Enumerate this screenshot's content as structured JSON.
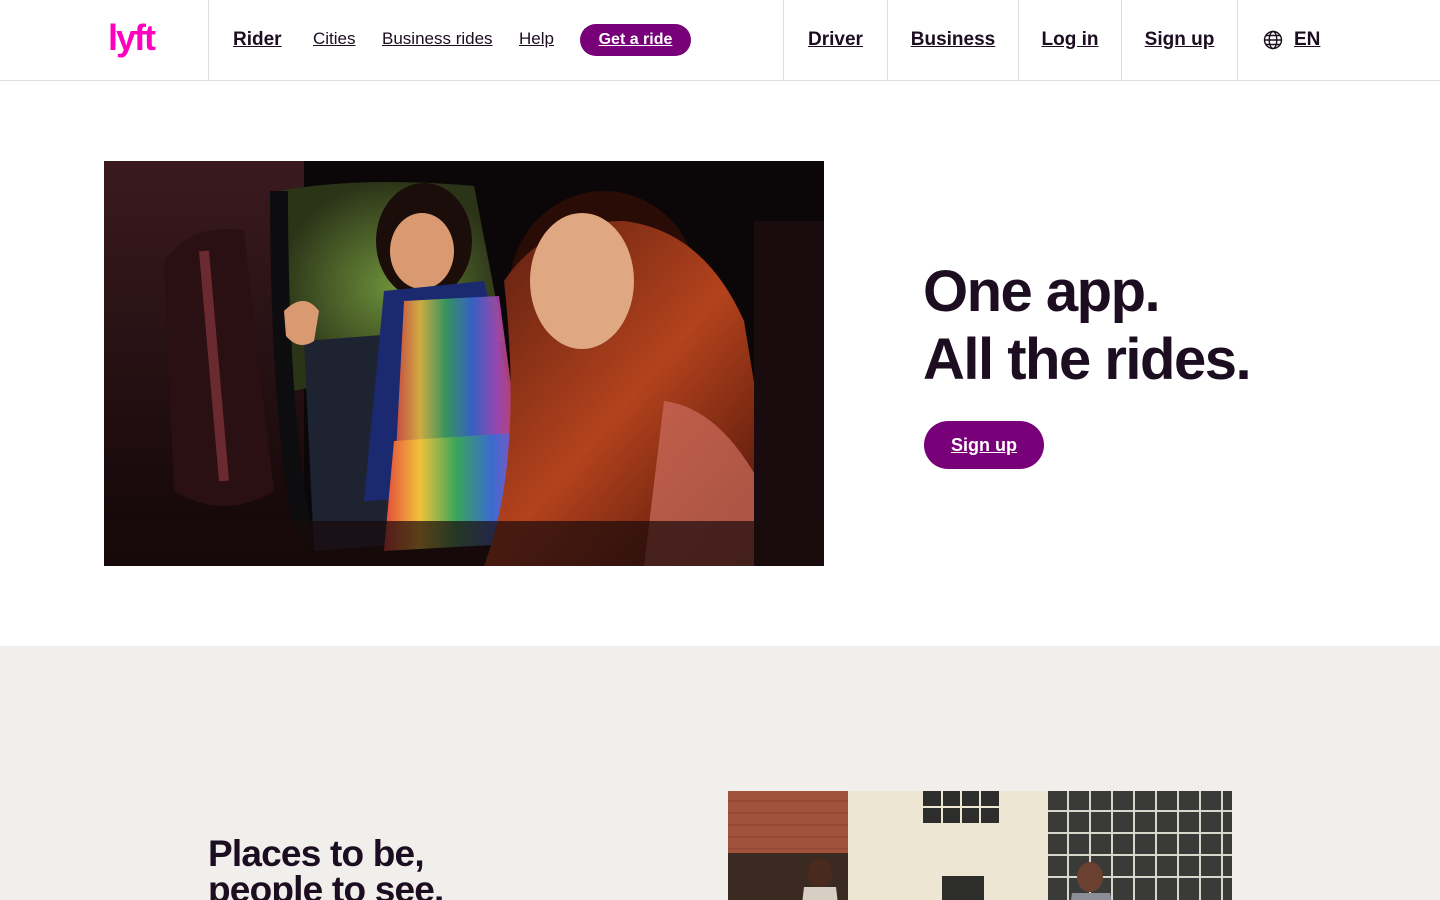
{
  "header": {
    "logo_text": "lyft",
    "nav_primary": "Rider",
    "nav_links": [
      "Cities",
      "Business rides",
      "Help"
    ],
    "cta_label": "Get a ride",
    "nav_right": [
      "Driver",
      "Business",
      "Log in",
      "Sign up"
    ],
    "language": "EN",
    "language_icon": "globe-icon"
  },
  "hero": {
    "title_line1": "One app.",
    "title_line2": "All the rides.",
    "signup_label": "Sign up"
  },
  "section2": {
    "title_line1": "Places to be,",
    "title_line2": "people to see."
  },
  "colors": {
    "brand_pink": "#ff00bf",
    "brand_purple": "#780078",
    "text_dark": "#1c0d20",
    "section_bg": "#f1efec"
  }
}
